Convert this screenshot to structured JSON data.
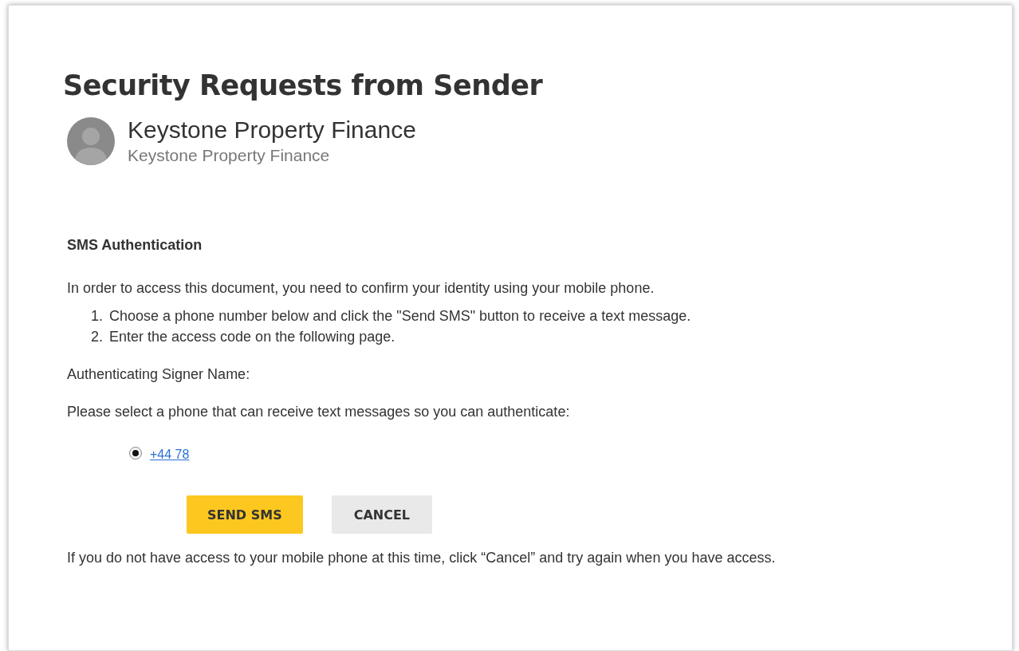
{
  "title": "Security Requests from Sender",
  "sender": {
    "name": "Keystone Property Finance",
    "subtitle": "Keystone Property Finance"
  },
  "section_title": "SMS Authentication",
  "intro": "In order to access this document, you need to confirm your identity using your mobile phone.",
  "steps": [
    {
      "number": "1.",
      "text": "Choose a phone number below and click the \"Send SMS\" button to receive a text message."
    },
    {
      "number": "2.",
      "text": "Enter the access code on the following page."
    }
  ],
  "signer_label": "Authenticating Signer Name:",
  "select_prompt": "Please select a phone that can receive text messages so you can authenticate:",
  "phones": [
    {
      "number": "+44 78",
      "selected": true
    }
  ],
  "buttons": [
    {
      "label": "SEND SMS",
      "kind": "primary"
    },
    {
      "label": "CANCEL",
      "kind": "secondary"
    }
  ],
  "footer": "If you do not have access to your mobile phone at this time, click “Cancel” and try again when you have access."
}
